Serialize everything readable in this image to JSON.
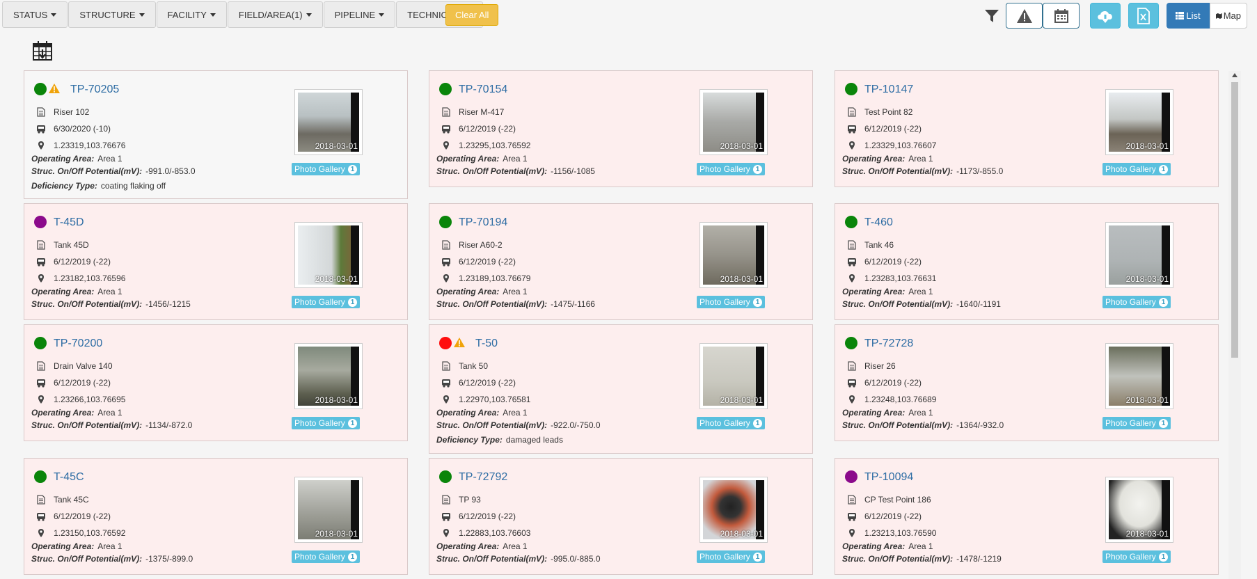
{
  "filters": {
    "status": "STATUS",
    "structure": "STRUCTURE",
    "facility": "FACILITY",
    "field_area": "FIELD/AREA(1)",
    "pipeline": "PIPELINE",
    "technician": "TECHNICIAN",
    "clear_all": "Clear All"
  },
  "views": {
    "list": "List",
    "map": "Map"
  },
  "labels": {
    "operating_area": "Operating Area:",
    "potential": "Struc. On/Off Potential(mV):",
    "deficiency": "Deficiency Type:",
    "photo_gallery": "Photo Gallery"
  },
  "colors": {
    "card_bg": "#fdeeee",
    "link": "#2e6da4",
    "cyan": "#5bc0de",
    "clear_btn": "#f0c14b"
  },
  "cards": [
    {
      "id": "TP-70205",
      "status": "green",
      "warning": true,
      "name": "Riser 102",
      "date": "6/30/2020 (-10)",
      "coords": "1.23319,103.76676",
      "area": "Area 1",
      "potential": "-991.0/-853.0",
      "deficiency": "coating flaking off",
      "photo_date": "2018-03-01",
      "photo_count": "1"
    },
    {
      "id": "TP-70154",
      "status": "green",
      "warning": false,
      "name": "Riser M-417",
      "date": "6/12/2019 (-22)",
      "coords": "1.23295,103.76592",
      "area": "Area 1",
      "potential": "-1156/-1085",
      "photo_date": "2018-03-01",
      "photo_count": "1"
    },
    {
      "id": "TP-10147",
      "status": "green",
      "warning": false,
      "name": "Test Point 82",
      "date": "6/12/2019 (-22)",
      "coords": "1.23329,103.76607",
      "area": "Area 1",
      "potential": "-1173/-855.0",
      "photo_date": "2018-03-01",
      "photo_count": "1"
    },
    {
      "id": "T-45D",
      "status": "purple",
      "warning": false,
      "name": "Tank 45D",
      "date": "6/12/2019 (-22)",
      "coords": "1.23182,103.76596",
      "area": "Area 1",
      "potential": "-1456/-1215",
      "photo_date": "2018-03-01",
      "photo_count": "1"
    },
    {
      "id": "TP-70194",
      "status": "green",
      "warning": false,
      "name": "Riser A60-2",
      "date": "6/12/2019 (-22)",
      "coords": "1.23189,103.76679",
      "area": "Area 1",
      "potential": "-1475/-1166",
      "photo_date": "2018-03-01",
      "photo_count": "1"
    },
    {
      "id": "T-460",
      "status": "green",
      "warning": false,
      "name": "Tank 46",
      "date": "6/12/2019 (-22)",
      "coords": "1.23283,103.76631",
      "area": "Area 1",
      "potential": "-1640/-1191",
      "photo_date": "2018-03-01",
      "photo_count": "1"
    },
    {
      "id": "TP-70200",
      "status": "green",
      "warning": false,
      "name": "Drain Valve 140",
      "date": "6/12/2019 (-22)",
      "coords": "1.23266,103.76695",
      "area": "Area 1",
      "potential": "-1134/-872.0",
      "photo_date": "2018-03-01",
      "photo_count": "1"
    },
    {
      "id": "T-50",
      "status": "red",
      "warning": true,
      "name": "Tank 50",
      "date": "6/12/2019 (-22)",
      "coords": "1.22970,103.76581",
      "area": "Area 1",
      "potential": "-922.0/-750.0",
      "deficiency": "damaged leads",
      "photo_date": "2018-03-01",
      "photo_count": "1"
    },
    {
      "id": "TP-72728",
      "status": "green",
      "warning": false,
      "name": "Riser 26",
      "date": "6/12/2019 (-22)",
      "coords": "1.23248,103.76689",
      "area": "Area 1",
      "potential": "-1364/-932.0",
      "photo_date": "2018-03-01",
      "photo_count": "1"
    },
    {
      "id": "T-45C",
      "status": "green",
      "warning": false,
      "name": "Tank 45C",
      "date": "6/12/2019 (-22)",
      "coords": "1.23150,103.76592",
      "area": "Area 1",
      "potential": "-1375/-899.0",
      "photo_date": "2018-03-01",
      "photo_count": "1"
    },
    {
      "id": "TP-72792",
      "status": "green",
      "warning": false,
      "name": "TP 93",
      "date": "6/12/2019 (-22)",
      "coords": "1.22883,103.76603",
      "area": "Area 1",
      "potential": "-995.0/-885.0",
      "photo_date": "2018-03-01",
      "photo_count": "1"
    },
    {
      "id": "TP-10094",
      "status": "purple",
      "warning": false,
      "name": "CP Test Point 186",
      "date": "6/12/2019 (-22)",
      "coords": "1.23213,103.76590",
      "area": "Area 1",
      "potential": "-1478/-1219",
      "photo_date": "2018-03-01",
      "photo_count": "1"
    }
  ]
}
